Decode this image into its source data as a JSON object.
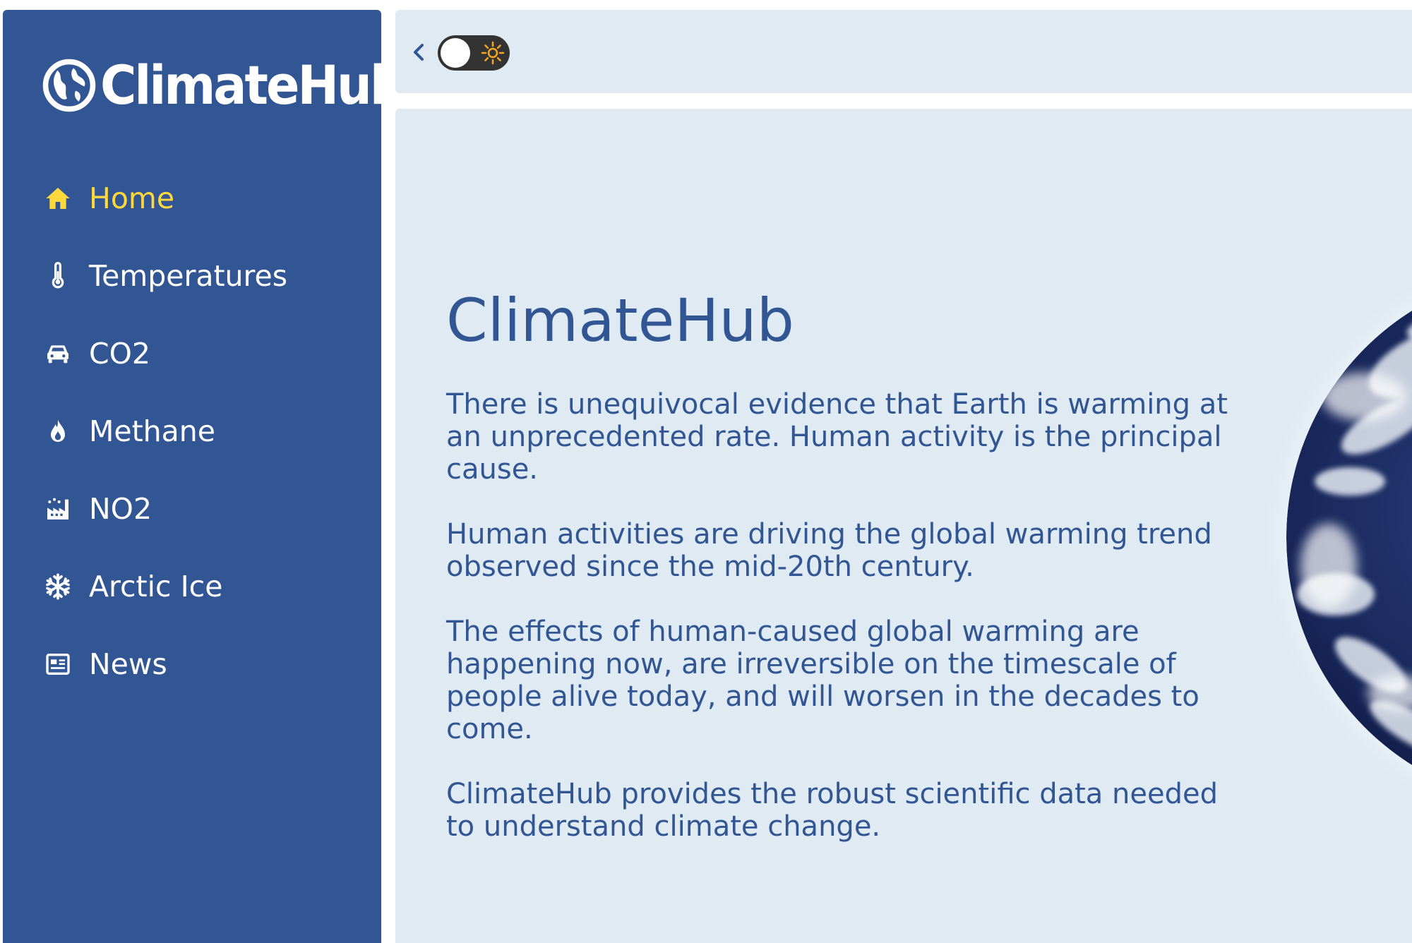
{
  "brand": {
    "name": "ClimateHub"
  },
  "sidebar": {
    "items": [
      {
        "label": "Home",
        "icon": "home-icon",
        "active": true
      },
      {
        "label": "Temperatures",
        "icon": "thermometer-icon",
        "active": false
      },
      {
        "label": "CO2",
        "icon": "car-icon",
        "active": false
      },
      {
        "label": "Methane",
        "icon": "flame-icon",
        "active": false
      },
      {
        "label": "NO2",
        "icon": "factory-icon",
        "active": false
      },
      {
        "label": "Arctic Ice",
        "icon": "snowflake-icon",
        "active": false
      },
      {
        "label": "News",
        "icon": "newspaper-icon",
        "active": false
      }
    ]
  },
  "topbar": {
    "theme_toggle": "light"
  },
  "main": {
    "title": "ClimateHub",
    "paragraphs": [
      "There is unequivocal evidence that Earth is warming at an unprecedented rate. Human activity is the principal cause.",
      "Human activities are driving the global warming trend observed since the mid-20th century.",
      "The effects of human-caused global warming are happening now, are irreversible on the timescale of people alive today, and will worsen in the decades to come.",
      "ClimateHub provides the robust scientific data needed to understand climate change."
    ]
  },
  "colors": {
    "sidebar_bg": "#325693",
    "active_nav": "#ffd83d",
    "panel_bg": "#dfeaf3",
    "text_primary": "#325693"
  }
}
